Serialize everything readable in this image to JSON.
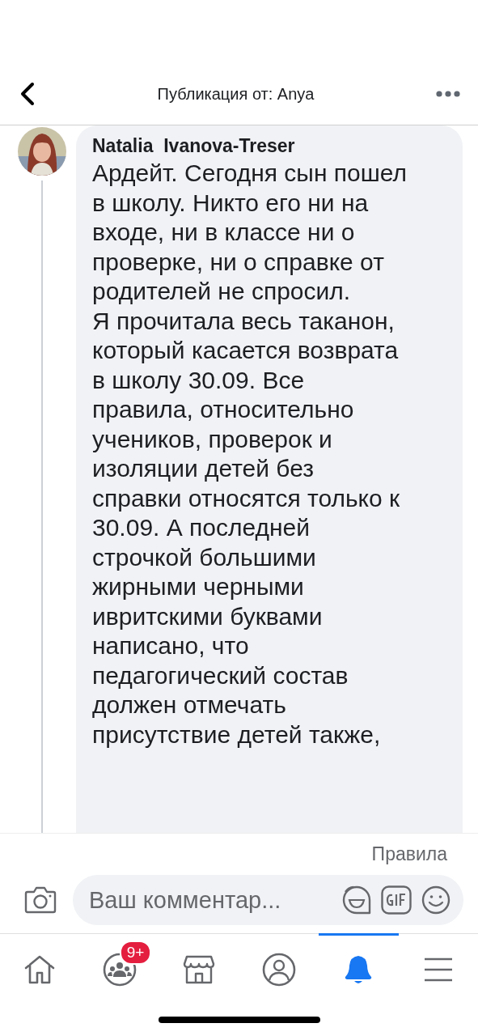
{
  "header": {
    "title": "Публикация от: Anya"
  },
  "comment": {
    "author": "Natalia  Ivanova-Treser",
    "text": "Ардейт. Сегодня сын пошел\nв школу. Никто его ни на\nвходе, ни в классе ни о\nпроверке, ни о справке от\nродителей не спросил.\nЯ прочитала весь таканон,\nкоторый касается возврата\nв школу 30.09. Все\nправила, относительно\nучеников, проверок и\nизоляции детей без\nсправки относятся только к\n30.09. А последней\nстрочкой большими\nжирными черными\nивритскими буквами\nнаписано, что\nпедагогический состав\nдолжен отмечать\nприсутствие детей также,"
  },
  "composer": {
    "rules_link": "Правила",
    "placeholder": "Ваш комментар..."
  },
  "tabs": [
    {
      "kind": "home",
      "selected": false
    },
    {
      "kind": "groups",
      "selected": false,
      "badge": "9+"
    },
    {
      "kind": "marketplace",
      "selected": false
    },
    {
      "kind": "profile",
      "selected": false
    },
    {
      "kind": "notifications",
      "selected": true
    },
    {
      "kind": "menu",
      "selected": false
    }
  ]
}
